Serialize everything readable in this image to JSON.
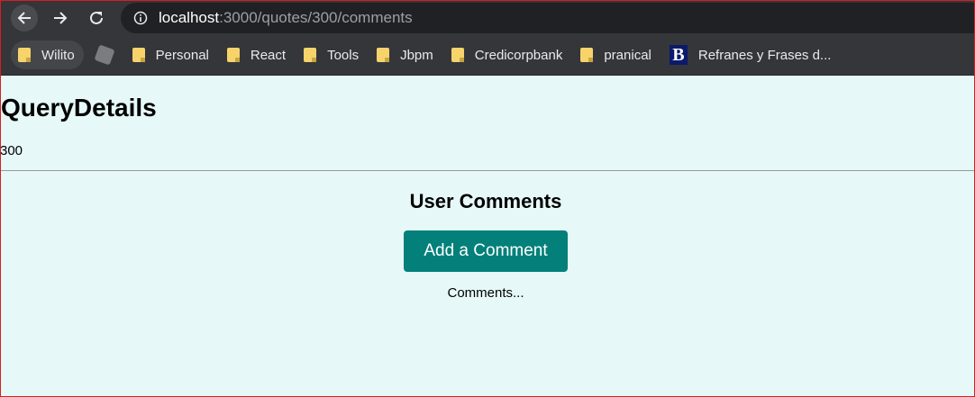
{
  "browser": {
    "url_host": "localhost",
    "url_path": ":3000/quotes/300/comments",
    "bookmarks": [
      {
        "label": "Wilito",
        "icon": "folder-icon"
      },
      {
        "label": "",
        "icon": "extension-icon"
      },
      {
        "label": "Personal",
        "icon": "folder-icon"
      },
      {
        "label": "React",
        "icon": "folder-icon"
      },
      {
        "label": "Tools",
        "icon": "folder-icon"
      },
      {
        "label": "Jbpm",
        "icon": "folder-icon"
      },
      {
        "label": "Credicorpbank",
        "icon": "folder-icon"
      },
      {
        "label": "pranical",
        "icon": "folder-icon"
      },
      {
        "label": "Refranes y Frases d...",
        "icon": "b-logo-icon"
      }
    ],
    "b_logo_letter": "B"
  },
  "page": {
    "title": "QueryDetails",
    "quote_id": "300",
    "section_title": "User Comments",
    "add_button_label": "Add a Comment",
    "comments_placeholder": "Comments..."
  },
  "colors": {
    "background": "#e6f8f8",
    "button": "#03807a",
    "chrome": "#35363a"
  }
}
